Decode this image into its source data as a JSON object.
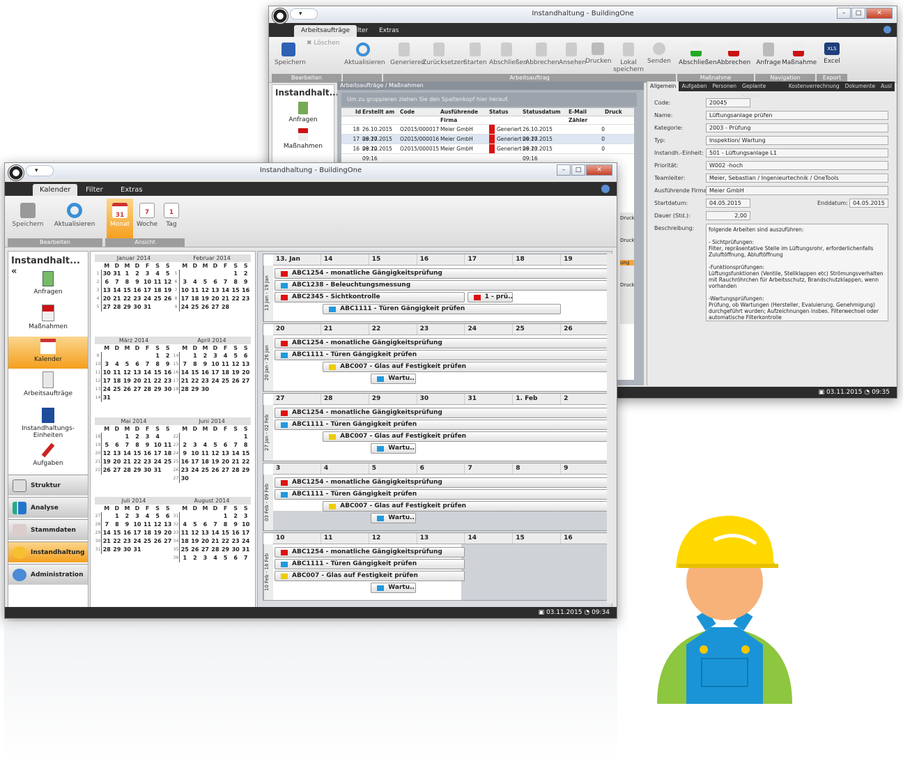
{
  "back": {
    "title": "Instandhaltung - BuildingOne",
    "tabs": [
      "Arbeitsaufträge",
      "Filter",
      "Extras"
    ],
    "ribbon": {
      "save": "Speichern",
      "delete": "Löschen",
      "refresh": "Aktualisieren",
      "generate": "Generieren",
      "reset": "Zurücksetzen",
      "start": "Starten",
      "finish": "Abschließen",
      "cancel": "Abbrechen",
      "view": "Ansehen",
      "print": "Drucken",
      "local1": "Lokal",
      "local2": "speichern",
      "send": "Senden",
      "m_finish": "Abschließen",
      "m_cancel": "Abbrechen",
      "request": "Anfrage",
      "measure": "Maßnahme",
      "excel": "Excel"
    },
    "groups": [
      "Bearbeiten",
      "Arbeitsauftrag",
      "Maßnahme",
      "Navigation",
      "Export"
    ],
    "navhead": "Instandhalt...",
    "nav": [
      "Anfragen",
      "Maßnahmen"
    ],
    "breadcrumb": "Arbeitsaufträge / Maßnahmen",
    "grouphint": "Um zu gruppieren ziehen Sie den Spaltenkopf hier herauf.",
    "cols": [
      "Id",
      "Erstellt am",
      "Code",
      "Ausführende Firma",
      "Status",
      "Statusdatum",
      "E-Mail Zähler",
      "Druck"
    ],
    "rows": [
      [
        "18",
        "26.10.2015 09:27",
        "O2015/000017",
        "Meier GmbH",
        "Generiert",
        "26.10.2015 09:27",
        "0"
      ],
      [
        "17",
        "26.10.2015 09:22",
        "O2015/000016",
        "Meier GmbH",
        "Generiert",
        "26.10.2015 09:23",
        "0"
      ],
      [
        "16",
        "26.10.2015 09:16",
        "O2015/000015",
        "Meier GmbH",
        "Generiert",
        "26.10.2015 09:16",
        "0"
      ]
    ],
    "rtabs": [
      "Allgemein",
      "Aufgaben",
      "Personen",
      "Geplante Kosten",
      "Kostenverrechnung",
      "Dokumente",
      "Ausl"
    ],
    "form": {
      "code_l": "Code:",
      "code": "20045",
      "name_l": "Name:",
      "name": "Lüftungsanlage prüfen",
      "kat_l": "Kategorie:",
      "kat": "2003 - Prüfung",
      "typ_l": "Typ:",
      "typ": "Inspektion/ Wartung",
      "einheit_l": "Instandh.-Einheit:",
      "einheit": "501 - Lüftungsanlage L1",
      "prio_l": "Priorität:",
      "prio": "W002 -hoch",
      "team_l": "Teamleiter:",
      "team": "Meier, Sebastian / Ingenieurtechnik / OneTools",
      "firma_l": "Ausführende Firma:",
      "firma": "Meier GmbH",
      "start_l": "Startdatum:",
      "start": "04.05.2015",
      "end_l": "Enddatum:",
      "end": "04.05.2015",
      "dauer_l": "Dauer (Std.):",
      "dauer": "2,00",
      "beschr_l": "Beschreibung:",
      "beschr": [
        "folgende Arbeiten sind auszuführen:",
        "",
        "- Sichtprüfungen:",
        "Filter, repräsentative Stelle im Lüftungsrohr, erforderlichenfalls Zuluftöffnung, Abluftöffnung",
        "",
        "-Funktionsprüfungen:",
        "Lüftungsfunktionen (Ventile, Stellklappen etc) Strömungsverhalten mit Rauchröhrchen für Arbeitsschutz, Brandschutzklappen, wenn vorhanden",
        "",
        "-Wartungsprüfungen:",
        "Prüfung, ob Wartungen (Hersteller, Evaluierung, Genehmigung) durchgeführt wurden; Aufzeichnungen insbes. Filterwechsel oder automatische Filterkontrolle"
      ]
    },
    "status": "03.11.2015",
    "time": "09:35",
    "druck": "Druck",
    "ung": "ung"
  },
  "front": {
    "title": "Instandhaltung - BuildingOne",
    "tabs": [
      "Kalender",
      "Filter",
      "Extras"
    ],
    "ribbon": {
      "save": "Speichern",
      "refresh": "Aktualisieren",
      "month": "Monat",
      "week": "Woche",
      "day": "Tag",
      "g1": "Bearbeiten",
      "g2": "Ansicht",
      "m31": "31",
      "w7": "7",
      "d1": "1"
    },
    "navhead": "Instandhalt... «",
    "nav": [
      "Anfragen",
      "Maßnahmen",
      "Kalender",
      "Arbeitsaufträge",
      "Instandhaltungs-Einheiten",
      "Aufgaben"
    ],
    "bars": [
      "Struktur",
      "Analyse",
      "Stammdaten",
      "Instandhaltung",
      "Administration"
    ],
    "status": "03.11.2015",
    "time": "09:34"
  },
  "months": [
    {
      "name": "Januar 2014",
      "rows": [
        [
          "1",
          "30",
          "31",
          "1",
          "2",
          "3",
          "4",
          "5"
        ],
        [
          "2",
          "6",
          "7",
          "8",
          "9",
          "10",
          "11",
          "12"
        ],
        [
          "3",
          "13",
          "14",
          "15",
          "16",
          "17",
          "18",
          "19"
        ],
        [
          "4",
          "20",
          "21",
          "22",
          "23",
          "24",
          "25",
          "26"
        ],
        [
          "5",
          "27",
          "28",
          "29",
          "30",
          "31",
          "",
          ""
        ]
      ]
    },
    {
      "name": "Februar 2014",
      "rows": [
        [
          "5",
          "",
          "",
          "",
          "",
          "",
          "1",
          "2"
        ],
        [
          "6",
          "3",
          "4",
          "5",
          "6",
          "7",
          "8",
          "9"
        ],
        [
          "7",
          "10",
          "11",
          "12",
          "13",
          "14",
          "15",
          "16"
        ],
        [
          "8",
          "17",
          "18",
          "19",
          "20",
          "21",
          "22",
          "23"
        ],
        [
          "9",
          "24",
          "25",
          "26",
          "27",
          "28",
          "",
          ""
        ]
      ]
    },
    {
      "name": "März 2014",
      "rows": [
        [
          "9",
          "",
          "",
          "",
          "",
          "",
          "1",
          "2"
        ],
        [
          "10",
          "3",
          "4",
          "5",
          "6",
          "7",
          "8",
          "9"
        ],
        [
          "11",
          "10",
          "11",
          "12",
          "13",
          "14",
          "15",
          "16"
        ],
        [
          "12",
          "17",
          "18",
          "19",
          "20",
          "21",
          "22",
          "23"
        ],
        [
          "13",
          "24",
          "25",
          "26",
          "27",
          "28",
          "29",
          "30"
        ],
        [
          "14",
          "31",
          "",
          "",
          "",
          "",
          "",
          ""
        ]
      ]
    },
    {
      "name": "April 2014",
      "rows": [
        [
          "14",
          "",
          "1",
          "2",
          "3",
          "4",
          "5",
          "6"
        ],
        [
          "15",
          "7",
          "8",
          "9",
          "10",
          "11",
          "12",
          "13"
        ],
        [
          "16",
          "14",
          "15",
          "16",
          "17",
          "18",
          "19",
          "20"
        ],
        [
          "17",
          "21",
          "22",
          "23",
          "24",
          "25",
          "26",
          "27"
        ],
        [
          "18",
          "28",
          "29",
          "30",
          "",
          "",
          "",
          ""
        ]
      ]
    },
    {
      "name": "Mai 2014",
      "rows": [
        [
          "18",
          "",
          "",
          "1",
          "2",
          "3",
          "4",
          ""
        ],
        [
          "19",
          "5",
          "6",
          "7",
          "8",
          "9",
          "10",
          "11"
        ],
        [
          "20",
          "12",
          "13",
          "14",
          "15",
          "16",
          "17",
          "18"
        ],
        [
          "21",
          "19",
          "20",
          "21",
          "22",
          "23",
          "24",
          "25"
        ],
        [
          "22",
          "26",
          "27",
          "28",
          "29",
          "30",
          "31",
          ""
        ]
      ]
    },
    {
      "name": "Juni 2014",
      "rows": [
        [
          "22",
          "",
          "",
          "",
          "",
          "",
          "",
          "1"
        ],
        [
          "23",
          "2",
          "3",
          "4",
          "5",
          "6",
          "7",
          "8"
        ],
        [
          "24",
          "9",
          "10",
          "11",
          "12",
          "13",
          "14",
          "15"
        ],
        [
          "25",
          "16",
          "17",
          "18",
          "19",
          "20",
          "21",
          "22"
        ],
        [
          "26",
          "23",
          "24",
          "25",
          "26",
          "27",
          "28",
          "29"
        ],
        [
          "27",
          "30",
          "",
          "",
          "",
          "",
          "",
          ""
        ]
      ]
    },
    {
      "name": "Juli 2014",
      "rows": [
        [
          "27",
          "",
          "1",
          "2",
          "3",
          "4",
          "5",
          "6"
        ],
        [
          "28",
          "7",
          "8",
          "9",
          "10",
          "11",
          "12",
          "13"
        ],
        [
          "29",
          "14",
          "15",
          "16",
          "17",
          "18",
          "19",
          "20"
        ],
        [
          "30",
          "21",
          "22",
          "23",
          "24",
          "25",
          "26",
          "27"
        ],
        [
          "31",
          "28",
          "29",
          "30",
          "31",
          "",
          "",
          ""
        ]
      ]
    },
    {
      "name": "August 2014",
      "rows": [
        [
          "31",
          "",
          "",
          "",
          "",
          "1",
          "2",
          "3"
        ],
        [
          "32",
          "4",
          "5",
          "6",
          "7",
          "8",
          "9",
          "10"
        ],
        [
          "33",
          "11",
          "12",
          "13",
          "14",
          "15",
          "16",
          "17"
        ],
        [
          "34",
          "18",
          "19",
          "20",
          "21",
          "22",
          "23",
          "24"
        ],
        [
          "35",
          "25",
          "26",
          "27",
          "28",
          "29",
          "30",
          "31"
        ],
        [
          "36",
          "1",
          "2",
          "3",
          "4",
          "5",
          "6",
          "7"
        ]
      ]
    }
  ],
  "weekdays": [
    "M",
    "D",
    "M",
    "D",
    "F",
    "S",
    "S"
  ],
  "weeks": [
    {
      "label": "13 Jan - 19 Jan",
      "days": [
        "13. Jan",
        "14",
        "15",
        "16",
        "17",
        "18",
        "19"
      ],
      "events": [
        [
          "ABC1254 - monatliche Gängigkeitsprüfung",
          "#d11"
        ],
        [
          "ABC1238 - Beleuchtungsmessung",
          "#29d"
        ],
        [
          "ABC2345 - Sichtkontrolle",
          "#d11"
        ],
        [
          "1 - prü...",
          "#d11"
        ],
        [
          "ABC1111 - Türen Gängigkeit prüfen",
          "#29d"
        ]
      ]
    },
    {
      "label": "20 Jan - 26 Jan",
      "days": [
        "20",
        "21",
        "22",
        "23",
        "24",
        "25",
        "26"
      ],
      "events": [
        [
          "ABC1254 - monatliche Gängigkeitsprüfung",
          "#d11"
        ],
        [
          "ABC1111 - Türen Gängigkeit prüfen",
          "#29d"
        ],
        [
          "ABC007 - Glas auf Festigkeit prüfen",
          "#ec0"
        ],
        [
          "Wartu...",
          "#29d"
        ]
      ]
    },
    {
      "label": "27 Jan - 02 Feb",
      "days": [
        "27",
        "28",
        "29",
        "30",
        "31",
        "1. Feb",
        "2"
      ],
      "events": [
        [
          "ABC1254 - monatliche Gängigkeitsprüfung",
          "#d11"
        ],
        [
          "ABC1111 - Türen Gängigkeit prüfen",
          "#29d"
        ],
        [
          "ABC007 - Glas auf Festigkeit prüfen",
          "#ec0"
        ],
        [
          "Wartu...",
          "#29d"
        ]
      ]
    },
    {
      "label": "03 Feb - 09 Feb",
      "days": [
        "3",
        "4",
        "5",
        "6",
        "7",
        "8",
        "9"
      ],
      "events": [
        [
          "ABC1254 - monatliche Gängigkeitsprüfung",
          "#d11"
        ],
        [
          "ABC1111 - Türen Gängigkeit prüfen",
          "#29d"
        ],
        [
          "ABC007 - Glas auf Festigkeit prüfen",
          "#ec0"
        ],
        [
          "Wartu...",
          "#29d"
        ]
      ]
    },
    {
      "label": "10 Feb - 16 Feb",
      "days": [
        "10",
        "11",
        "12",
        "13",
        "14",
        "15",
        "16"
      ],
      "events": [
        [
          "ABC1254 - monatliche Gängigkeitsprüfung",
          "#d11"
        ],
        [
          "ABC1111 - Türen Gängigkeit prüfen",
          "#29d"
        ],
        [
          "ABC007 - Glas auf Festigkeit prüfen",
          "#ec0"
        ],
        [
          "Wartu...",
          "#29d"
        ]
      ]
    }
  ]
}
